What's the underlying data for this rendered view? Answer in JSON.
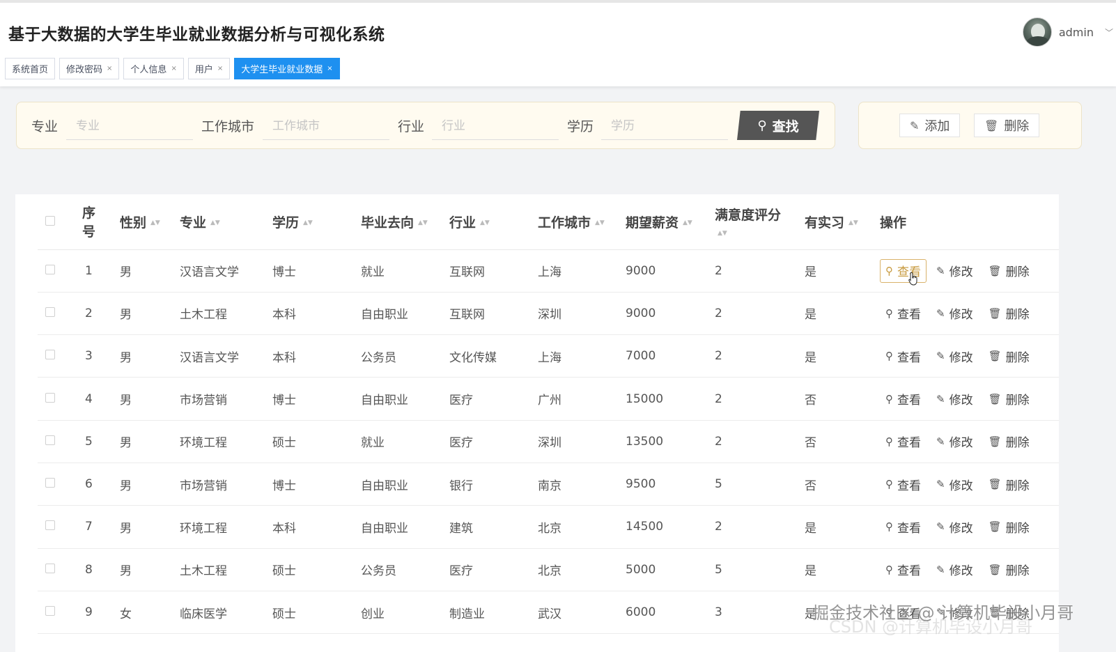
{
  "app_title": "基于大数据的大学生毕业就业数据分析与可视化系统",
  "user": {
    "name": "admin",
    "caret": "﹀"
  },
  "tabs": [
    {
      "label": "系统首页",
      "closable": ""
    },
    {
      "label": "修改密码",
      "closable": "×"
    },
    {
      "label": "个人信息",
      "closable": "×"
    },
    {
      "label": "用户",
      "closable": "×"
    },
    {
      "label": "大学生毕业就业数据",
      "closable": "×"
    }
  ],
  "search": {
    "major_label": "专业",
    "major_placeholder": "专业",
    "city_label": "工作城市",
    "city_placeholder": "工作城市",
    "industry_label": "行业",
    "industry_placeholder": "行业",
    "edu_label": "学历",
    "edu_placeholder": "学历",
    "button": "查找"
  },
  "actions": {
    "add": "添加",
    "delete": "删除"
  },
  "table": {
    "headers": {
      "index_1": "序",
      "index_2": "号",
      "gender": "性别",
      "major": "专业",
      "education": "学历",
      "destination": "毕业去向",
      "industry": "行业",
      "city": "工作城市",
      "salary": "期望薪资",
      "satisfaction": "满意度评分",
      "internship": "有实习",
      "ops": "操作"
    },
    "sort_glyph": "▲▼",
    "op_view": "查看",
    "op_edit": "修改",
    "op_delete": "删除",
    "rows": [
      [
        "1",
        "男",
        "汉语言文学",
        "博士",
        "就业",
        "互联网",
        "上海",
        "9000",
        "2",
        "是"
      ],
      [
        "2",
        "男",
        "土木工程",
        "本科",
        "自由职业",
        "互联网",
        "深圳",
        "9000",
        "2",
        "是"
      ],
      [
        "3",
        "男",
        "汉语言文学",
        "本科",
        "公务员",
        "文化传媒",
        "上海",
        "7000",
        "2",
        "是"
      ],
      [
        "4",
        "男",
        "市场营销",
        "博士",
        "自由职业",
        "医疗",
        "广州",
        "15000",
        "2",
        "否"
      ],
      [
        "5",
        "男",
        "环境工程",
        "硕士",
        "就业",
        "医疗",
        "深圳",
        "13500",
        "2",
        "否"
      ],
      [
        "6",
        "男",
        "市场营销",
        "博士",
        "自由职业",
        "银行",
        "南京",
        "9500",
        "5",
        "否"
      ],
      [
        "7",
        "男",
        "环境工程",
        "本科",
        "自由职业",
        "建筑",
        "北京",
        "14500",
        "2",
        "是"
      ],
      [
        "8",
        "男",
        "土木工程",
        "硕士",
        "公务员",
        "医疗",
        "北京",
        "5000",
        "5",
        "是"
      ],
      [
        "9",
        "女",
        "临床医学",
        "硕士",
        "创业",
        "制造业",
        "武汉",
        "6000",
        "3",
        "是"
      ]
    ]
  },
  "watermark": "掘金技术社区 @ 计算机毕设小月哥",
  "watermark2": "CSDN @计算机毕设小月哥",
  "colors": {
    "active_tab": "#1e90f0",
    "search_button": "#555555",
    "card_bg": "#fffbf0",
    "hover_op": "#c79a3f"
  }
}
